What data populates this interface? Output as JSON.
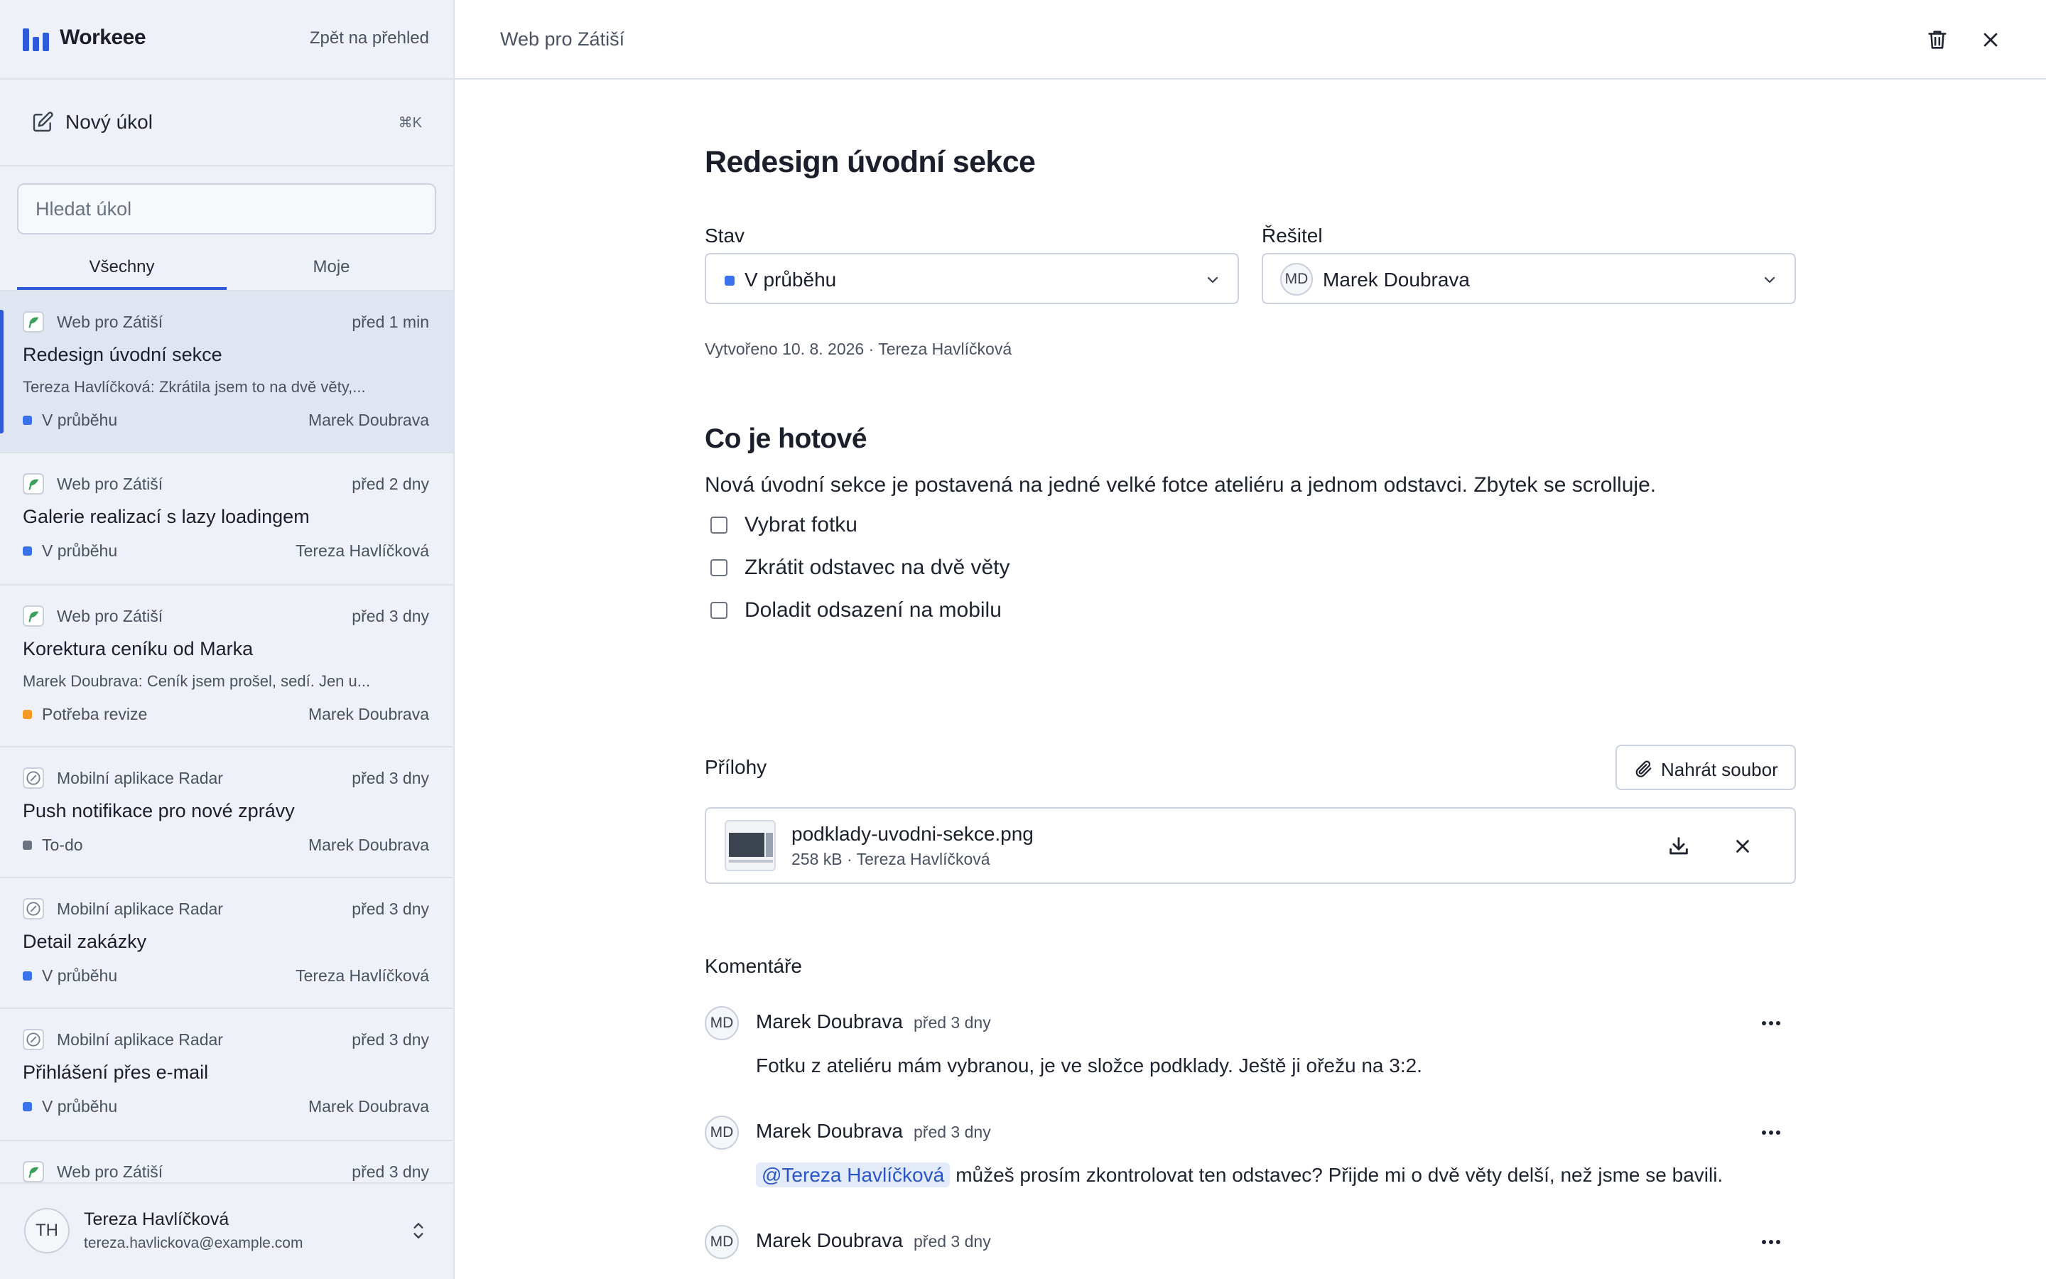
{
  "sidebar": {
    "brand": "Workeee",
    "back_link": "Zpět na přehled",
    "new_task_label": "Nový úkol",
    "new_task_shortcut": "⌘K",
    "search_placeholder": "Hledat úkol",
    "tabs": [
      "Všechny",
      "Moje"
    ],
    "tasks": [
      {
        "project": "Web pro Zátiší",
        "time": "před 1 min",
        "title": "Redesign úvodní sekce",
        "preview": "Tereza Havlíčková: Zkrátila jsem to na dvě věty,...",
        "status": "V průběhu",
        "assignee": "Marek Doubrava"
      },
      {
        "project": "Web pro Zátiší",
        "time": "před 2 dny",
        "title": "Galerie realizací s lazy loadingem",
        "preview": "",
        "status": "V průběhu",
        "assignee": "Tereza Havlíčková"
      },
      {
        "project": "Web pro Zátiší",
        "time": "před 3 dny",
        "title": "Korektura ceníku od Marka",
        "preview": "Marek Doubrava: Ceník jsem prošel, sedí. Jen u...",
        "status": "Potřeba revize",
        "assignee": "Marek Doubrava"
      },
      {
        "project": "Mobilní aplikace Radar",
        "time": "před 3 dny",
        "title": "Push notifikace pro nové zprávy",
        "preview": "",
        "status": "To-do",
        "assignee": "Marek Doubrava"
      },
      {
        "project": "Mobilní aplikace Radar",
        "time": "před 3 dny",
        "title": "Detail zakázky",
        "preview": "",
        "status": "V průběhu",
        "assignee": "Tereza Havlíčková"
      },
      {
        "project": "Mobilní aplikace Radar",
        "time": "před 3 dny",
        "title": "Přihlášení přes e-mail",
        "preview": "",
        "status": "V průběhu",
        "assignee": "Marek Doubrava"
      },
      {
        "project": "Web pro Zátiší",
        "time": "před 3 dny",
        "title": "",
        "preview": "",
        "status": "",
        "assignee": ""
      }
    ],
    "user": {
      "initials": "TH",
      "name": "Tereza Havlíčková",
      "email": "tereza.havlickova@example.com"
    }
  },
  "topbar": {
    "crumb": "Web pro Zátiší"
  },
  "task": {
    "title": "Redesign úvodní sekce",
    "status_label": "Stav",
    "status_value": "V průběhu",
    "assignee_label": "Řešitel",
    "assignee_initials": "MD",
    "assignee_value": "Marek Doubrava",
    "meta": "Vytvořeno 10. 8. 2026 · Tereza Havlíčková",
    "done_heading": "Co je hotové",
    "description": "Nová úvodní sekce je postavená na jedné velké fotce ateliéru a jednom odstavci. Zbytek se scrolluje.",
    "checklist": [
      "Vybrat fotku",
      "Zkrátit odstavec na dvě věty",
      "Doladit odsazení na mobilu"
    ],
    "attachments_heading": "Přílohy",
    "upload_label": "Nahrát soubor",
    "attachment": {
      "name": "podklady-uvodni-sekce.png",
      "meta": "258 kB · Tereza Havlíčková"
    },
    "comments_heading": "Komentáře",
    "comments": [
      {
        "initials": "MD",
        "author": "Marek Doubrava",
        "time": "před 3 dny",
        "mention": "",
        "text": "Fotku z ateliéru mám vybranou, je ve složce podklady. Ještě ji ořežu na 3:2."
      },
      {
        "initials": "MD",
        "author": "Marek Doubrava",
        "time": "před 3 dny",
        "mention": "@Tereza Havlíčková",
        "text": "můžeš prosím zkontrolovat ten odstavec? Přijde mi o dvě věty delší, než jsme se bavili."
      },
      {
        "initials": "MD",
        "author": "Marek Doubrava",
        "time": "před 3 dny",
        "mention": "",
        "text": ""
      }
    ]
  },
  "colors": {
    "accent": "#2f5ad9",
    "in_progress": "#3a72ec",
    "review": "#f59a23",
    "todo": "#6b7280",
    "project_leaf": "#3aa05a"
  },
  "icons": {
    "brand": "bars-logo",
    "new_task": "edit-icon",
    "project_web": "leaf-icon",
    "project_mobile": "compass-icon",
    "trash": "trash-icon",
    "close": "close-icon",
    "chevron": "chevron-down-icon",
    "upload": "paperclip-icon",
    "download": "download-icon",
    "more": "more-icon"
  }
}
